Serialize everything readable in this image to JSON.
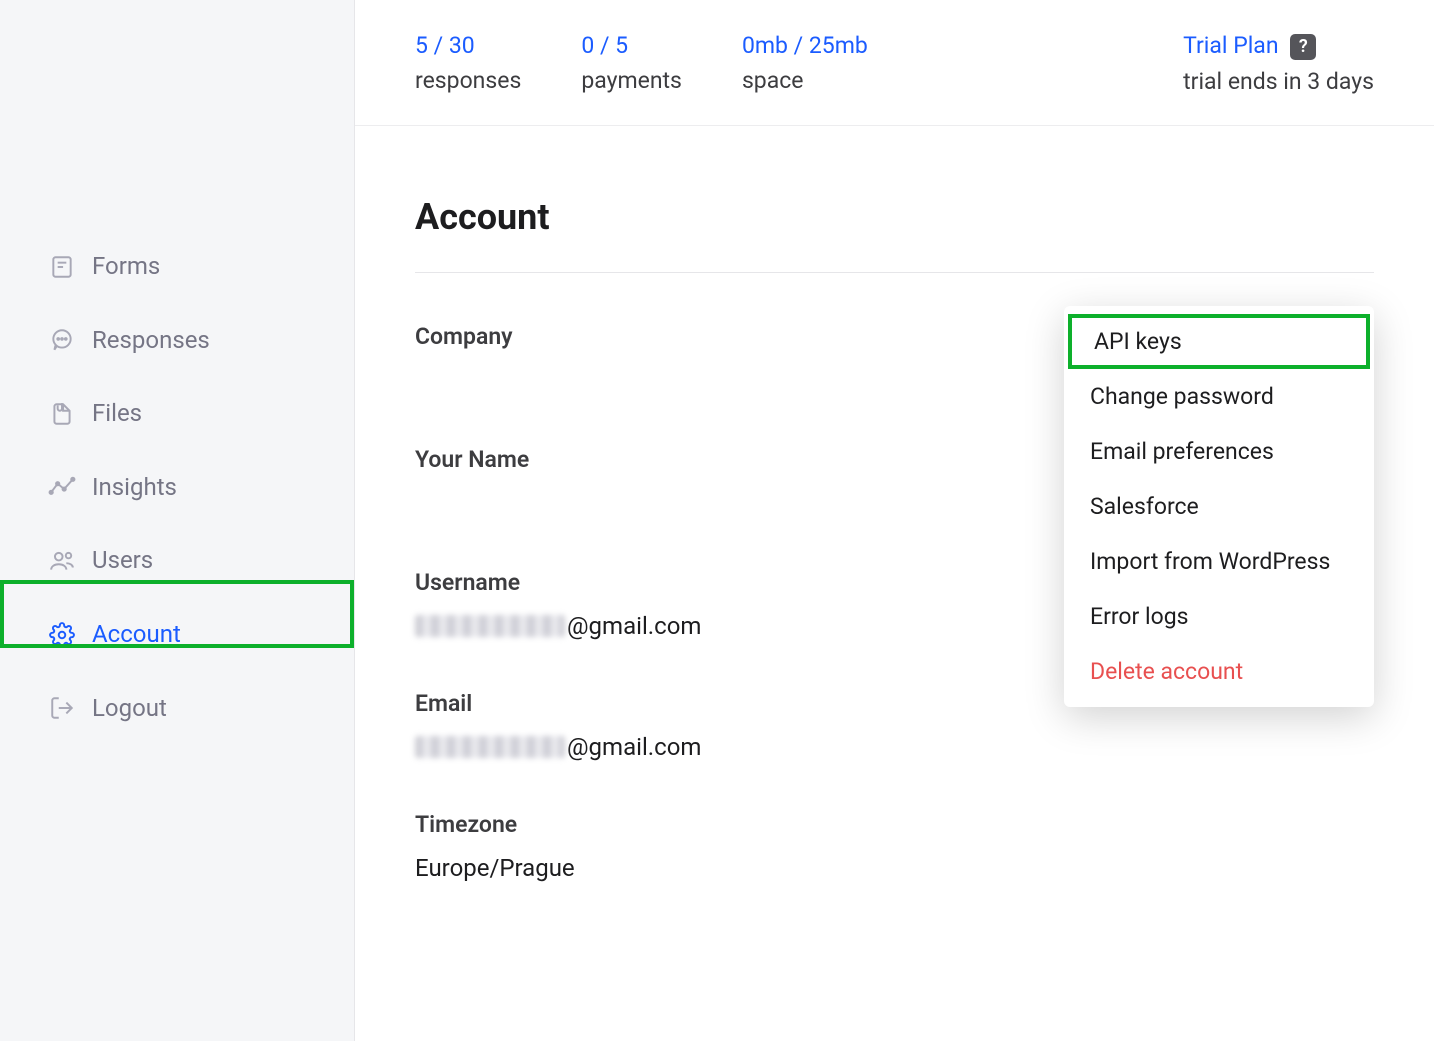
{
  "sidebar": {
    "items": [
      {
        "label": "Forms"
      },
      {
        "label": "Responses"
      },
      {
        "label": "Files"
      },
      {
        "label": "Insights"
      },
      {
        "label": "Users"
      },
      {
        "label": "Account"
      },
      {
        "label": "Logout"
      }
    ]
  },
  "topbar": {
    "responses": {
      "value": "5 / 30",
      "label": "responses"
    },
    "payments": {
      "value": "0 / 5",
      "label": "payments"
    },
    "space": {
      "value": "0mb / 25mb",
      "label": "space"
    },
    "plan": {
      "value": "Trial Plan",
      "label": "trial ends in 3 days"
    }
  },
  "page": {
    "title": "Account",
    "fields": {
      "company": {
        "label": "Company",
        "value": ""
      },
      "name": {
        "label": "Your Name",
        "value": ""
      },
      "username": {
        "label": "Username",
        "value_suffix": "@gmail.com"
      },
      "email": {
        "label": "Email",
        "value_suffix": "@gmail.com"
      },
      "timezone": {
        "label": "Timezone",
        "value": "Europe/Prague"
      }
    }
  },
  "dropdown": {
    "items": [
      {
        "label": "API keys"
      },
      {
        "label": "Change password"
      },
      {
        "label": "Email preferences"
      },
      {
        "label": "Salesforce"
      },
      {
        "label": "Import from WordPress"
      },
      {
        "label": "Error logs"
      },
      {
        "label": "Delete account"
      }
    ]
  },
  "colors": {
    "accent": "#1b5cff",
    "highlight": "#0db02b",
    "danger": "#e85050"
  }
}
